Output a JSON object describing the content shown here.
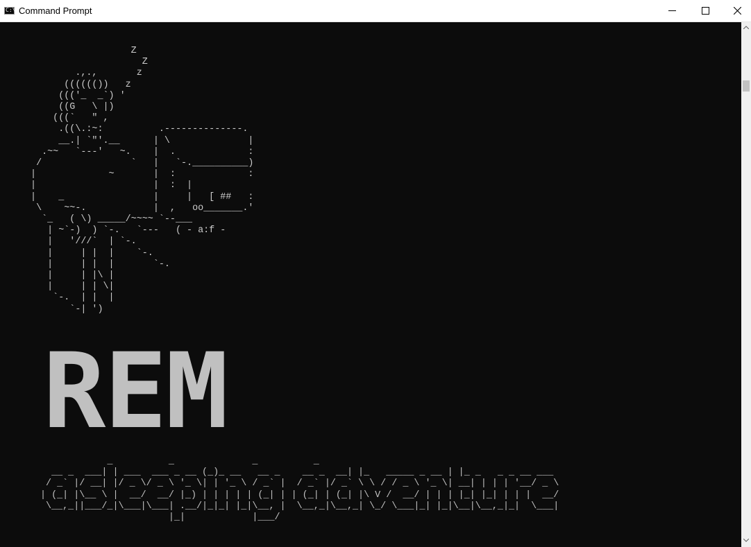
{
  "window": {
    "title": "Command Prompt",
    "icon": "cmd-icon",
    "icon_text": "C:\\"
  },
  "console": {
    "ascii_art": "                   Z\n                     Z\n         .,.,       z\n       (((((())   z\n      ((('_  _`) '\n      ((G   \\ |)\n     (((`   \" ,\n      .((\\.:~:          .--------------.\n      __.| `\"'.__      | \\              |\n   .~~   `---'   ~.    |  .             :\n  /                `   |   `-.__________)\n |             ~       |  :             :\n |                     |  :  |\n |    _                |     |   [ ##   :\n  \\    ~~-.            |  ,   oo_______.'\n   `_   ( \\) _____/~~~~ `--___\n    | ~`-)  ) `-.   `---   ( - a:f -\n    |   '///`  | `-.\n    |     | |  |    `-.\n    |     | |  |       `-.\n    |     | |\\ |\n    |     | | \\|\n     `-.  | |  |\n        `-| ')",
    "logo_text": "REM",
    "tagline_art": "            _          _              _          _\n  __ _  ___| | ___  ___ _ __ (_)_ __   __ _    __ _  __| |_   _____ _ __ | |_ _   _ _ __ ___\n / _` |/ __| |/ _ \\/ _ \\ '_ \\| | '_ \\ / _` |  / _` |/ _` \\ \\ / / _ \\ '_ \\| __| | | | '__/ _ \\\n| (_| |\\__ \\ |  __/  __/ |_) | | | | | (_| | | (_| | (_| |\\ V /  __/ | | | |_| |_| | | |  __/\n \\__,_||___/_|\\___|\\___| .__/|_|_| |_|\\__, |  \\__,_|\\__,_| \\_/ \\___|_| |_|\\__|\\__,_|_|  \\___|\n                       |_|            |___/"
  },
  "colors": {
    "console_bg": "#0c0c0c",
    "console_fg": "#cccccc",
    "titlebar_bg": "#ffffff",
    "scrollbar_bg": "#f0f0f0",
    "scroll_thumb": "#c2c2c2"
  },
  "controls": {
    "minimize": "minimize-icon",
    "maximize": "maximize-icon",
    "close": "close-icon"
  }
}
